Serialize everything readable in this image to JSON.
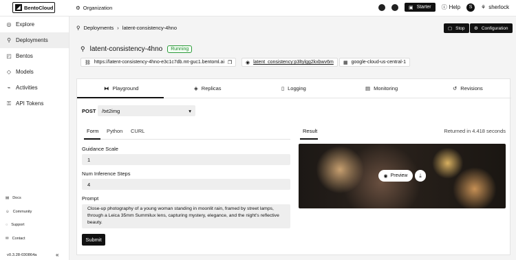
{
  "topbar": {
    "logo_text": "BentoCloud",
    "org_label": "Organization",
    "plan_label": "Starter",
    "help_label": "Help",
    "avatar_letter": "S",
    "username": "sherlock"
  },
  "sidebar": {
    "items": [
      {
        "label": "Explore",
        "icon": "compass-icon"
      },
      {
        "label": "Deployments",
        "icon": "rocket-icon"
      },
      {
        "label": "Bentos",
        "icon": "box-icon"
      },
      {
        "label": "Models",
        "icon": "cube-icon"
      },
      {
        "label": "Activities",
        "icon": "activity-icon"
      },
      {
        "label": "API Tokens",
        "icon": "key-icon"
      }
    ],
    "footer": [
      {
        "label": "Docs"
      },
      {
        "label": "Community"
      },
      {
        "label": "Support"
      },
      {
        "label": "Contact"
      }
    ],
    "version": "v0.3.28-030864a"
  },
  "breadcrumb": {
    "root": "Deployments",
    "current": "latent-consistency-4hno"
  },
  "header_buttons": {
    "stop": "Stop",
    "configuration": "Configuration"
  },
  "deployment": {
    "name": "latent-consistency-4hno",
    "status": "Running",
    "url": "https://latent-consistency-4hno-e3c1c7db.mt-guc1.bentoml.ai",
    "bento": "latent_consistency:p3ltylgg2kxbwv6m",
    "cluster": "google-cloud-us-central-1"
  },
  "tabs": [
    "Playground",
    "Replicas",
    "Logging",
    "Monitoring",
    "Revisions"
  ],
  "playground": {
    "method": "POST",
    "endpoint": "/txt2img",
    "subtabs": [
      "Form",
      "Python",
      "CURL"
    ],
    "fields": [
      {
        "label": "Guidance Scale",
        "value": "1"
      },
      {
        "label": "Num Inference Steps",
        "value": "4"
      }
    ],
    "prompt_label": "Prompt",
    "prompt_value": "Close-up photography of a young woman standing in moonlit rain, framed by street lamps, through a Leica 35mm Summilux lens, capturing mystery, elegance, and the night's reflective beauty.",
    "submit_label": "Submit",
    "result_label": "Result",
    "returned_text": "Returned in 4.418 seconds",
    "preview_label": "Preview"
  },
  "colors": {
    "accent": "#111111",
    "running": "#1f8a30"
  }
}
